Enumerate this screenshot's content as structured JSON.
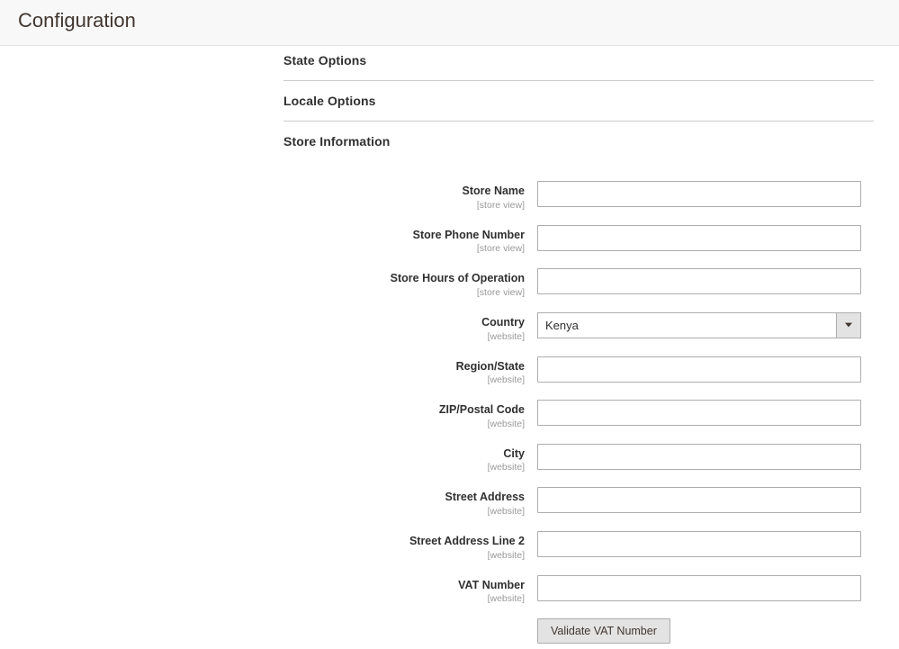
{
  "header": {
    "title": "Configuration"
  },
  "sections": {
    "state_options": {
      "label": "State Options"
    },
    "locale_options": {
      "label": "Locale Options"
    },
    "store_information": {
      "label": "Store Information"
    }
  },
  "fields": {
    "store_name": {
      "label": "Store Name",
      "scope": "[store view]",
      "value": ""
    },
    "store_phone": {
      "label": "Store Phone Number",
      "scope": "[store view]",
      "value": ""
    },
    "store_hours": {
      "label": "Store Hours of Operation",
      "scope": "[store view]",
      "value": ""
    },
    "country": {
      "label": "Country",
      "scope": "[website]",
      "value": "Kenya"
    },
    "region_state": {
      "label": "Region/State",
      "scope": "[website]",
      "value": ""
    },
    "zip": {
      "label": "ZIP/Postal Code",
      "scope": "[website]",
      "value": ""
    },
    "city": {
      "label": "City",
      "scope": "[website]",
      "value": ""
    },
    "street1": {
      "label": "Street Address",
      "scope": "[website]",
      "value": ""
    },
    "street2": {
      "label": "Street Address Line 2",
      "scope": "[website]",
      "value": ""
    },
    "vat": {
      "label": "VAT Number",
      "scope": "[website]",
      "value": ""
    }
  },
  "buttons": {
    "validate_vat": "Validate VAT Number"
  }
}
